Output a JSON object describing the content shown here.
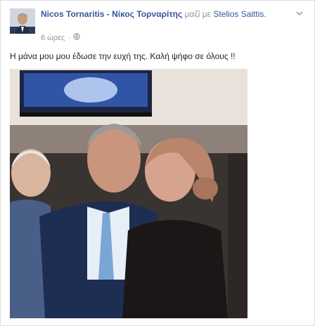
{
  "post": {
    "author": "Nicos Tornaritis - Νίκος Τορναρίτης",
    "with_word": "μαζί με",
    "tagged": "Stelios Saittis.",
    "timestamp": "6 ώρες",
    "separator": "·",
    "message": "Η μάνα μου μου έδωσε την ευχή της. Καλή ψήφο σε όλους !!"
  },
  "icons": {
    "privacy": "globe-icon",
    "menu": "chevron-down-icon"
  },
  "colors": {
    "link": "#365899",
    "meta": "#90949c",
    "text": "#1d2129"
  }
}
